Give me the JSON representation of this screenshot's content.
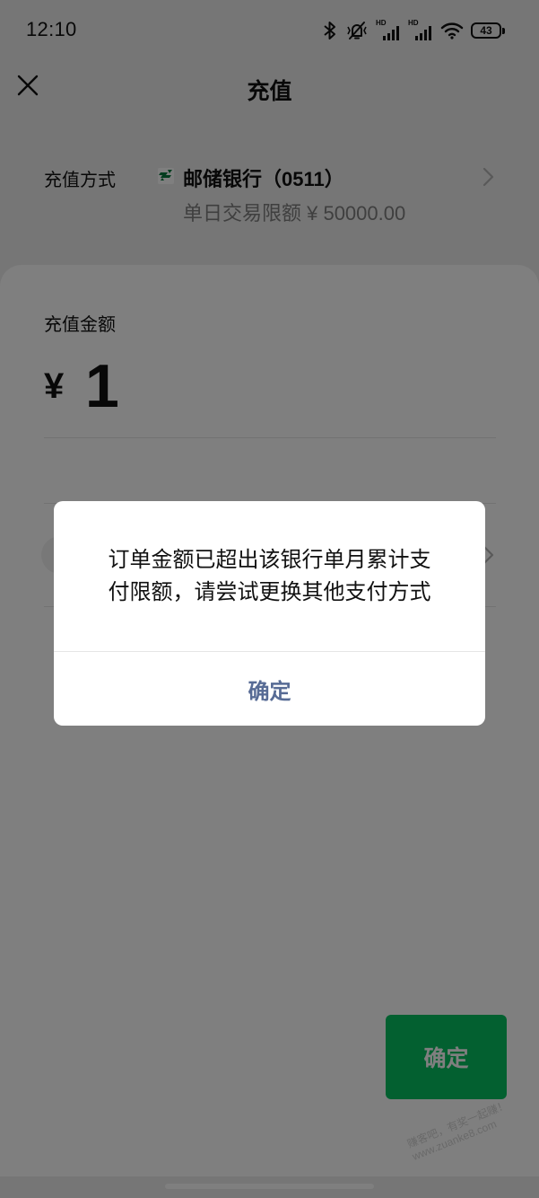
{
  "status_bar": {
    "time": "12:10",
    "icons": [
      "bluetooth-icon",
      "vibrate-off-icon",
      "signal-icon",
      "signal-icon",
      "wifi-icon",
      "battery-icon"
    ],
    "network_badges": [
      "HD",
      "HD"
    ],
    "battery_level": "43"
  },
  "header": {
    "close_icon": "close-icon",
    "title": "充值"
  },
  "method": {
    "label": "充值方式",
    "bank_logo_icon": "bank-logo-icon",
    "bank_name": "邮储银行（0511）",
    "limit": "单日交易限额 ¥ 50000.00",
    "chevron_icon": "chevron-right-icon"
  },
  "amount": {
    "label": "充值金额",
    "currency": "¥",
    "value": "1"
  },
  "dialog": {
    "message_lines": [
      "订单金额已超出该银行单月累计支",
      "付限额，请尝试更换其他支付方式"
    ],
    "confirm_label": "确定"
  },
  "primary_button": {
    "label": "确定"
  },
  "watermark": {
    "line1": "赚客吧，有奖一起赚！",
    "line2": "www.zuanke8.com"
  },
  "colors": {
    "accent_green": "#07c160",
    "dialog_link": "#576b95",
    "text_primary": "#111111",
    "text_secondary": "#7f7f7f",
    "page_background": "#ededed",
    "divider": "#e5e5e5",
    "overlay": "rgba(0,0,0,0.5)"
  }
}
